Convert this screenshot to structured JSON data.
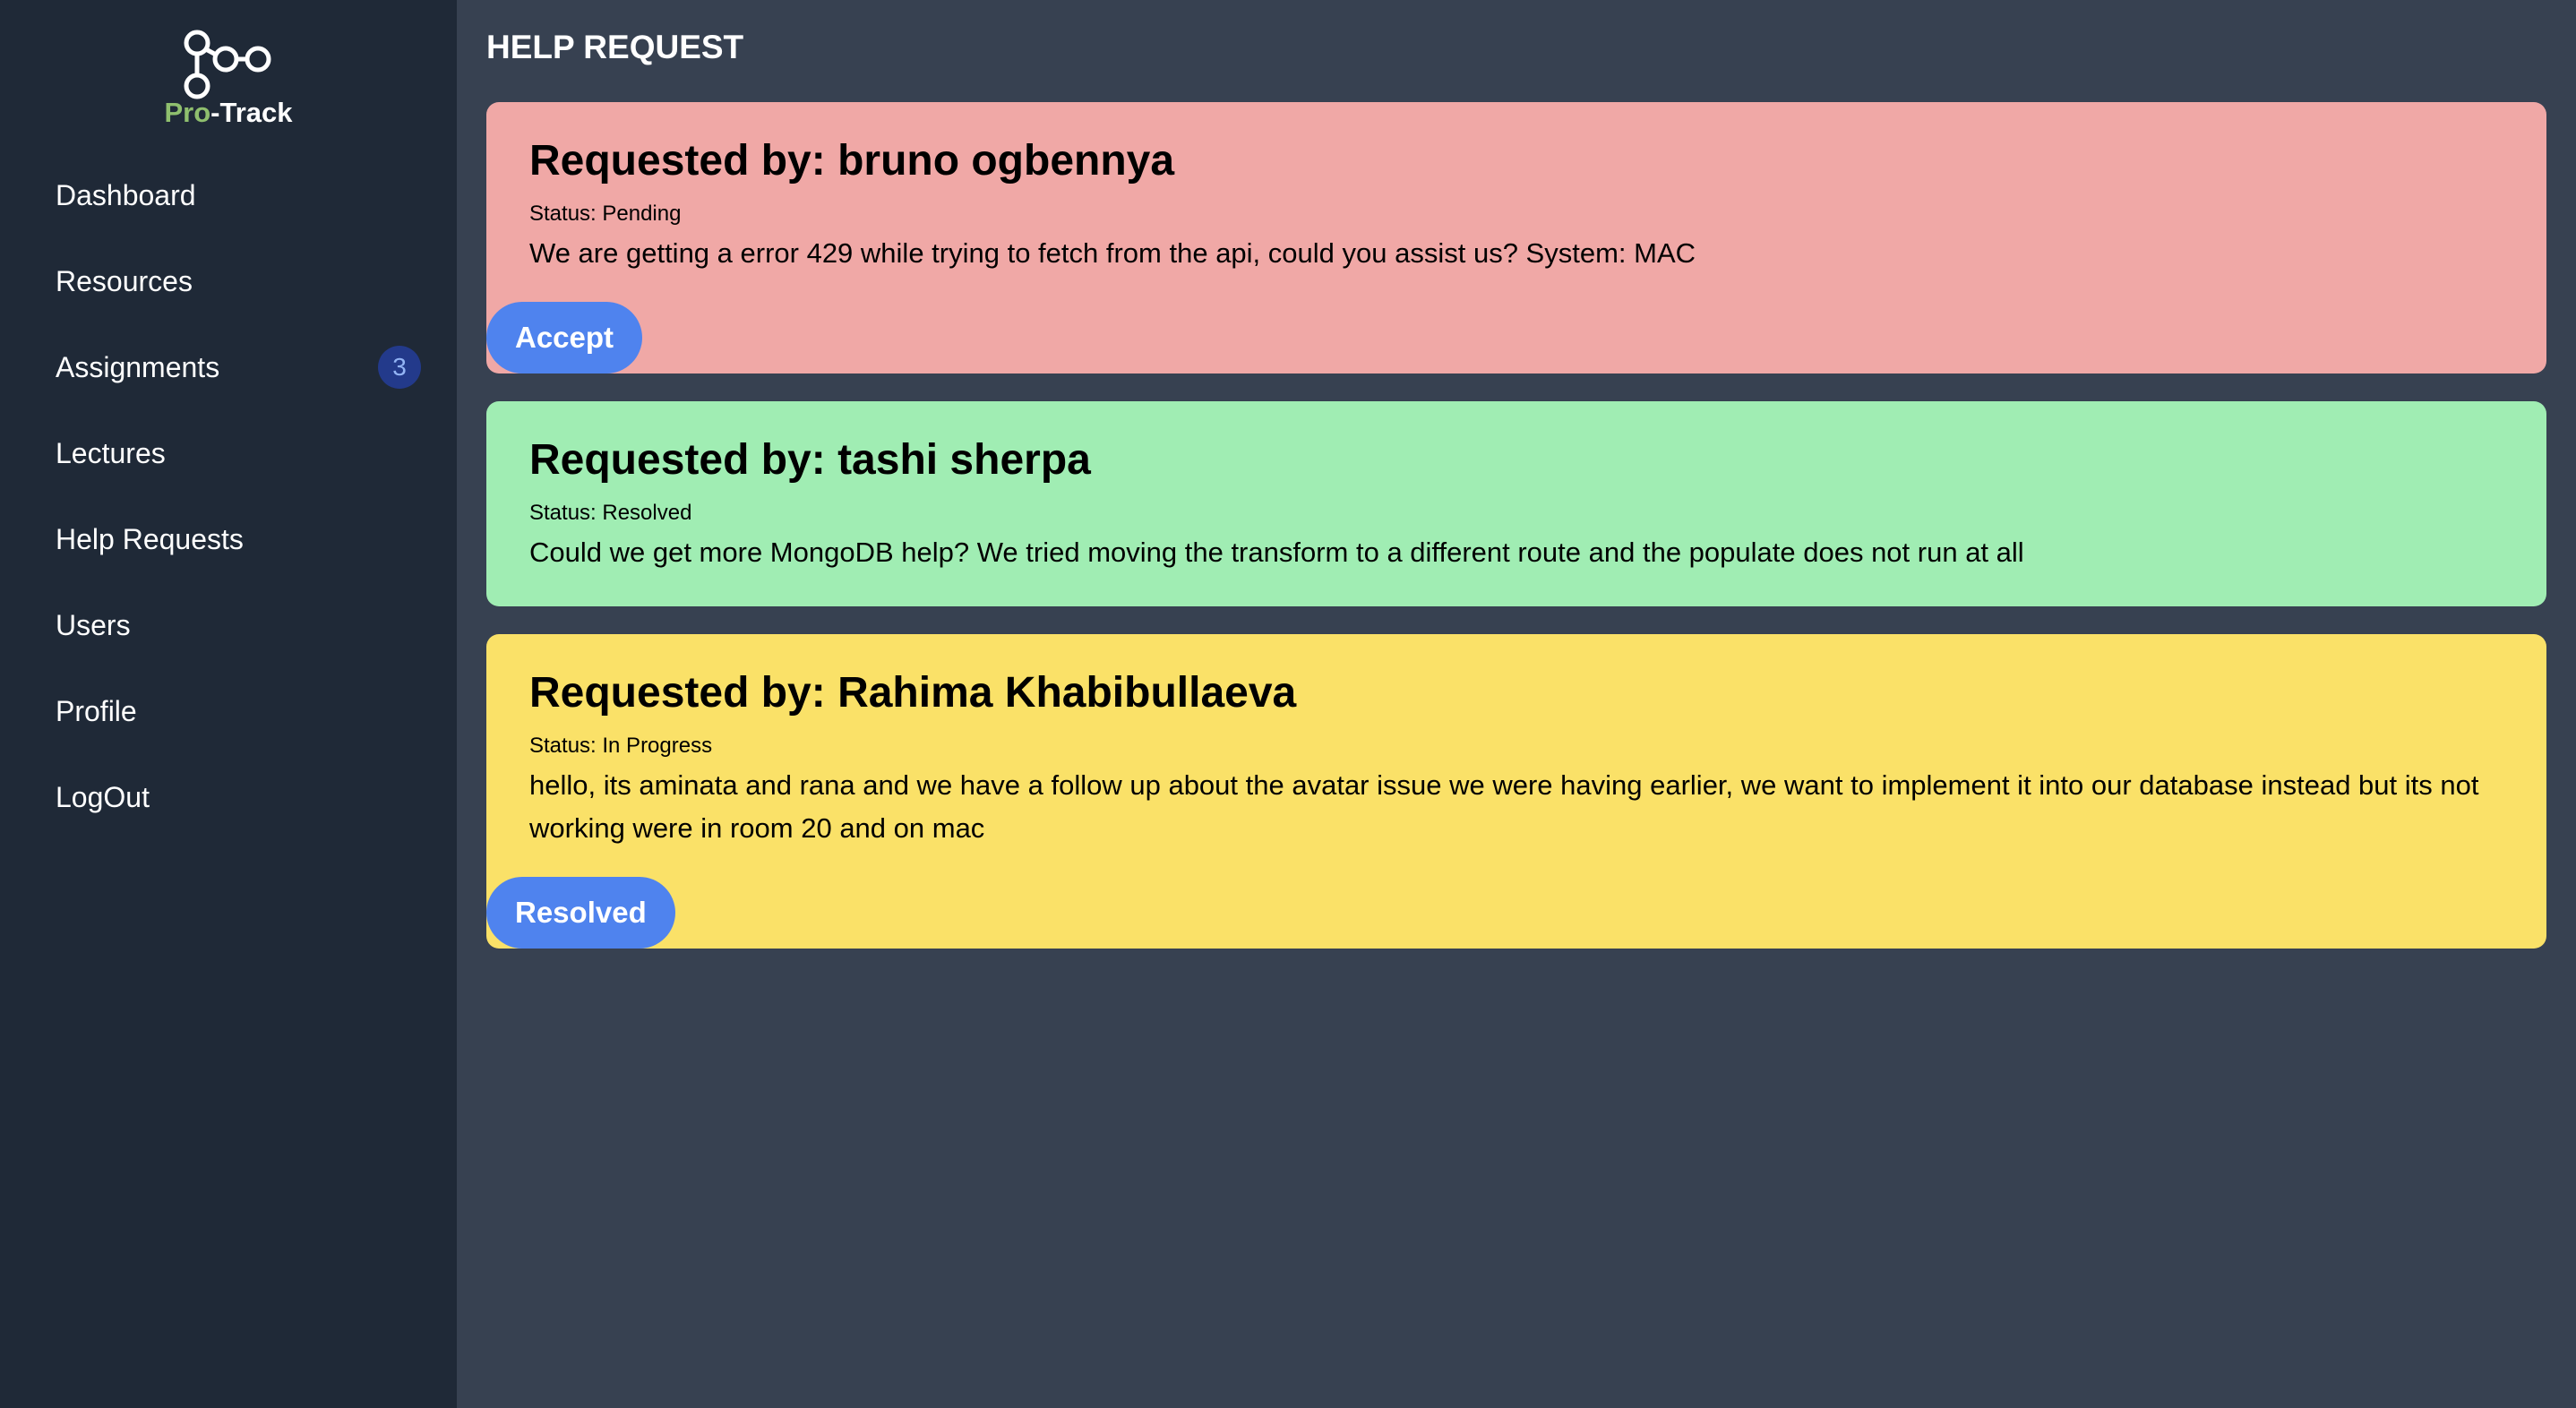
{
  "app": {
    "logo_pro": "Pro",
    "logo_track": "-Track"
  },
  "sidebar": {
    "items": [
      {
        "label": "Dashboard"
      },
      {
        "label": "Resources"
      },
      {
        "label": "Assignments",
        "badge": "3"
      },
      {
        "label": "Lectures"
      },
      {
        "label": "Help Requests"
      },
      {
        "label": "Users"
      },
      {
        "label": "Profile"
      },
      {
        "label": "LogOut"
      }
    ]
  },
  "main": {
    "title": "HELP REQUEST",
    "requests": [
      {
        "heading": "Requested by: bruno ogbennya",
        "status": "Status: Pending",
        "message": "We are getting a error 429 while trying to fetch from the api, could you assist us? System: MAC",
        "button": "Accept",
        "color": "#f0a8a6"
      },
      {
        "heading": "Requested by: tashi sherpa",
        "status": "Status: Resolved",
        "message": "Could we get more MongoDB help? We tried moving the transform to a different route and the populate does not run at all",
        "color": "#a0edb3"
      },
      {
        "heading": "Requested by: Rahima Khabibullaeva",
        "status": "Status: In Progress",
        "message": "hello, its aminata and rana and we have a follow up about the avatar issue we were having earlier, we want to implement it into our database instead but its not working were in room 20 and on mac",
        "button": "Resolved",
        "color": "#fae168"
      }
    ]
  }
}
